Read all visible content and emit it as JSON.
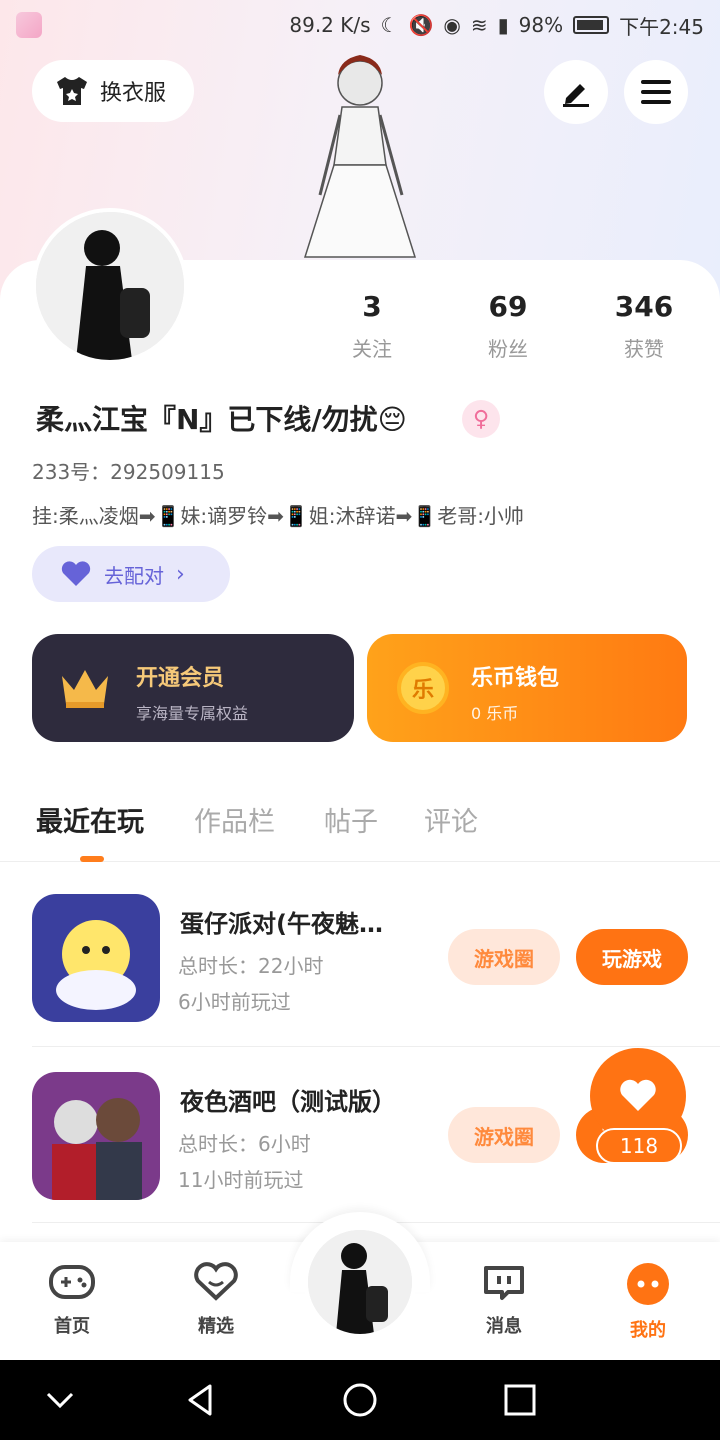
{
  "status_bar": {
    "speed": "89.2 K/s",
    "battery": "98%",
    "time": "下午2:45"
  },
  "header": {
    "dress_label": "换衣服"
  },
  "profile": {
    "stats": [
      {
        "num": "3",
        "label": "关注"
      },
      {
        "num": "69",
        "label": "粉丝"
      },
      {
        "num": "346",
        "label": "获赞"
      }
    ],
    "username": "柔灬江宝『N』已下线/勿扰😔",
    "gender_symbol": "♀",
    "uid": "233号：292509115",
    "bio": "挂:柔灬凌烟➡📱妹:谪罗铃➡📱姐:沐辞诺➡📱老哥:小帅",
    "match_label": "去配对"
  },
  "cards": {
    "vip_title": "开通会员",
    "vip_sub": "享海量专属权益",
    "wallet_title": "乐币钱包",
    "wallet_sub": "0 乐币",
    "wallet_coin": "乐"
  },
  "tabs": [
    "最近在玩",
    "作品栏",
    "帖子",
    "评论"
  ],
  "games": [
    {
      "title": "蛋仔派对(午夜魅…",
      "duration": "总时长：22小时",
      "last_played": "6小时前玩过",
      "circle_label": "游戏圈",
      "play_label": "玩游戏"
    },
    {
      "title": "夜色酒吧（测试版）",
      "duration": "总时长：6小时",
      "last_played": "11小时前玩过",
      "circle_label": "游戏圈",
      "play_label": "玩游戏"
    }
  ],
  "like": {
    "count": "118"
  },
  "bottom_nav": [
    {
      "label": "首页"
    },
    {
      "label": "精选"
    },
    {
      "label": "消息"
    },
    {
      "label": "我的"
    }
  ],
  "colors": {
    "accent": "#ff7313",
    "vip_bg": "#2e2b3d",
    "match_bg": "#e8e8fb",
    "match_text": "#6663d8"
  }
}
